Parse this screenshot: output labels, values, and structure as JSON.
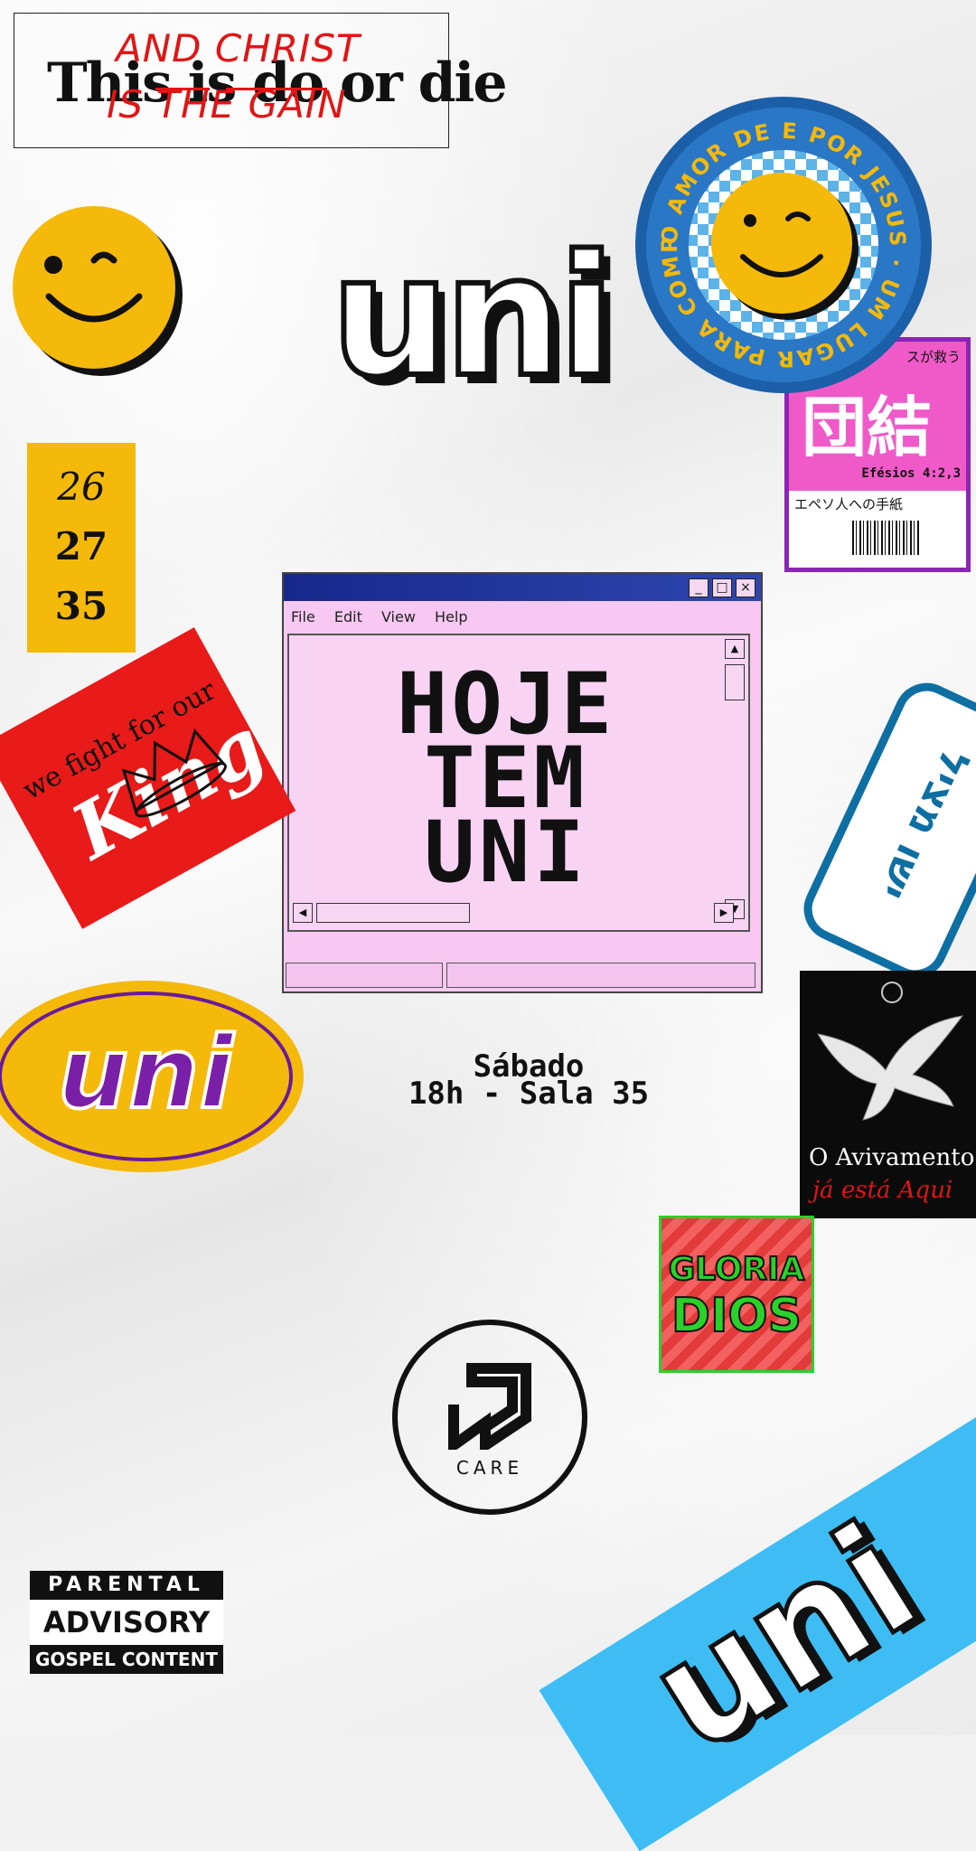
{
  "quote": {
    "main": "This is do or die",
    "overlay_line1": "AND CHRIST",
    "overlay_line2": "IS THE GAIN"
  },
  "title_uni": "uni",
  "badge": {
    "ring_text": "O AMOR DE E POR JESUS · UM LUGAR PARA COMPARTILHAR"
  },
  "japanese_card": {
    "top": "スが救う",
    "kanji": "団結",
    "ref": "Efésios 4:2,3",
    "bottom": "エペソ人への手紙"
  },
  "numbers": [
    "26",
    "27",
    "35"
  ],
  "window": {
    "menu": [
      "File",
      "Edit",
      "View",
      "Help"
    ],
    "headline": [
      "HOJE",
      "TEM",
      "UNI"
    ],
    "minimize": "_",
    "maximize": "□",
    "close": "×"
  },
  "king_sticker": {
    "line1": "we fight for our",
    "line2": "King"
  },
  "hebrew_sticker": {
    "text": "ישו מציל"
  },
  "event": {
    "line1": "Sábado",
    "line2": "18h - Sala 35"
  },
  "oval_uni": "uni",
  "dove_card": {
    "line1": "O Avivamento",
    "line2": "já está Aqui"
  },
  "gloria": {
    "line1": "GLORIA",
    "line2": "DIOS"
  },
  "care_logo": {
    "label": "CARE"
  },
  "advisory": {
    "line1": "PARENTAL",
    "line2": "ADVISORY",
    "line3": "GOSPEL CONTENT"
  },
  "banner_uni": "uni",
  "colors": {
    "yellow": "#f5b90a",
    "red": "#e91a1a",
    "blue": "#3dbdf3",
    "purple": "#8a25b6",
    "pink": "#f7c8f2",
    "green": "#2ad12a"
  }
}
